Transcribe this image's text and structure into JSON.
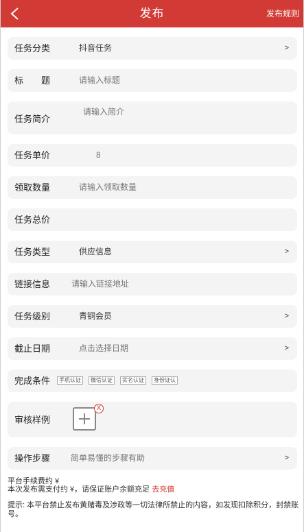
{
  "header": {
    "title": "发布",
    "rules": "发布规则"
  },
  "form": {
    "category": {
      "label": "任务分类",
      "value": "抖音任务",
      "arrow": ">"
    },
    "title": {
      "label": "标　　题",
      "placeholder": "请输入标题"
    },
    "intro": {
      "label": "任务简介",
      "placeholder": "请输入简介"
    },
    "unit_price": {
      "label": "任务单价",
      "value": "8"
    },
    "quantity": {
      "label": "领取数量",
      "placeholder": "请输入领取数量"
    },
    "total_price": {
      "label": "任务总价",
      "value": ""
    },
    "type": {
      "label": "任务类型",
      "value": "供应信息",
      "arrow": ">"
    },
    "link": {
      "label": "链接信息",
      "placeholder": "请输入链接地址"
    },
    "level": {
      "label": "任务级别",
      "value": "青铜会员",
      "arrow": ">"
    },
    "deadline": {
      "label": "截止日期",
      "placeholder": "点击选择日期",
      "arrow": ">"
    },
    "conditions": {
      "label": "完成条件",
      "badges": [
        "手机认证",
        "微信认证",
        "实名认证",
        "身份证认"
      ]
    },
    "sample": {
      "label": "审核样例",
      "close": "X"
    },
    "steps": {
      "label": "操作步骤",
      "placeholder": "简单易懂的步骤有助",
      "arrow": ">"
    }
  },
  "footer": {
    "fee_line": "平台手续费约 ¥",
    "pay_line": "本次发布需支付约 ¥，请保证账户余额充足",
    "recharge": "去充值",
    "tips": "提示: 本平台禁止发布黄赌毒及涉政等一切法律所禁止的内容，如发现扣除积分，封禁账号。"
  }
}
